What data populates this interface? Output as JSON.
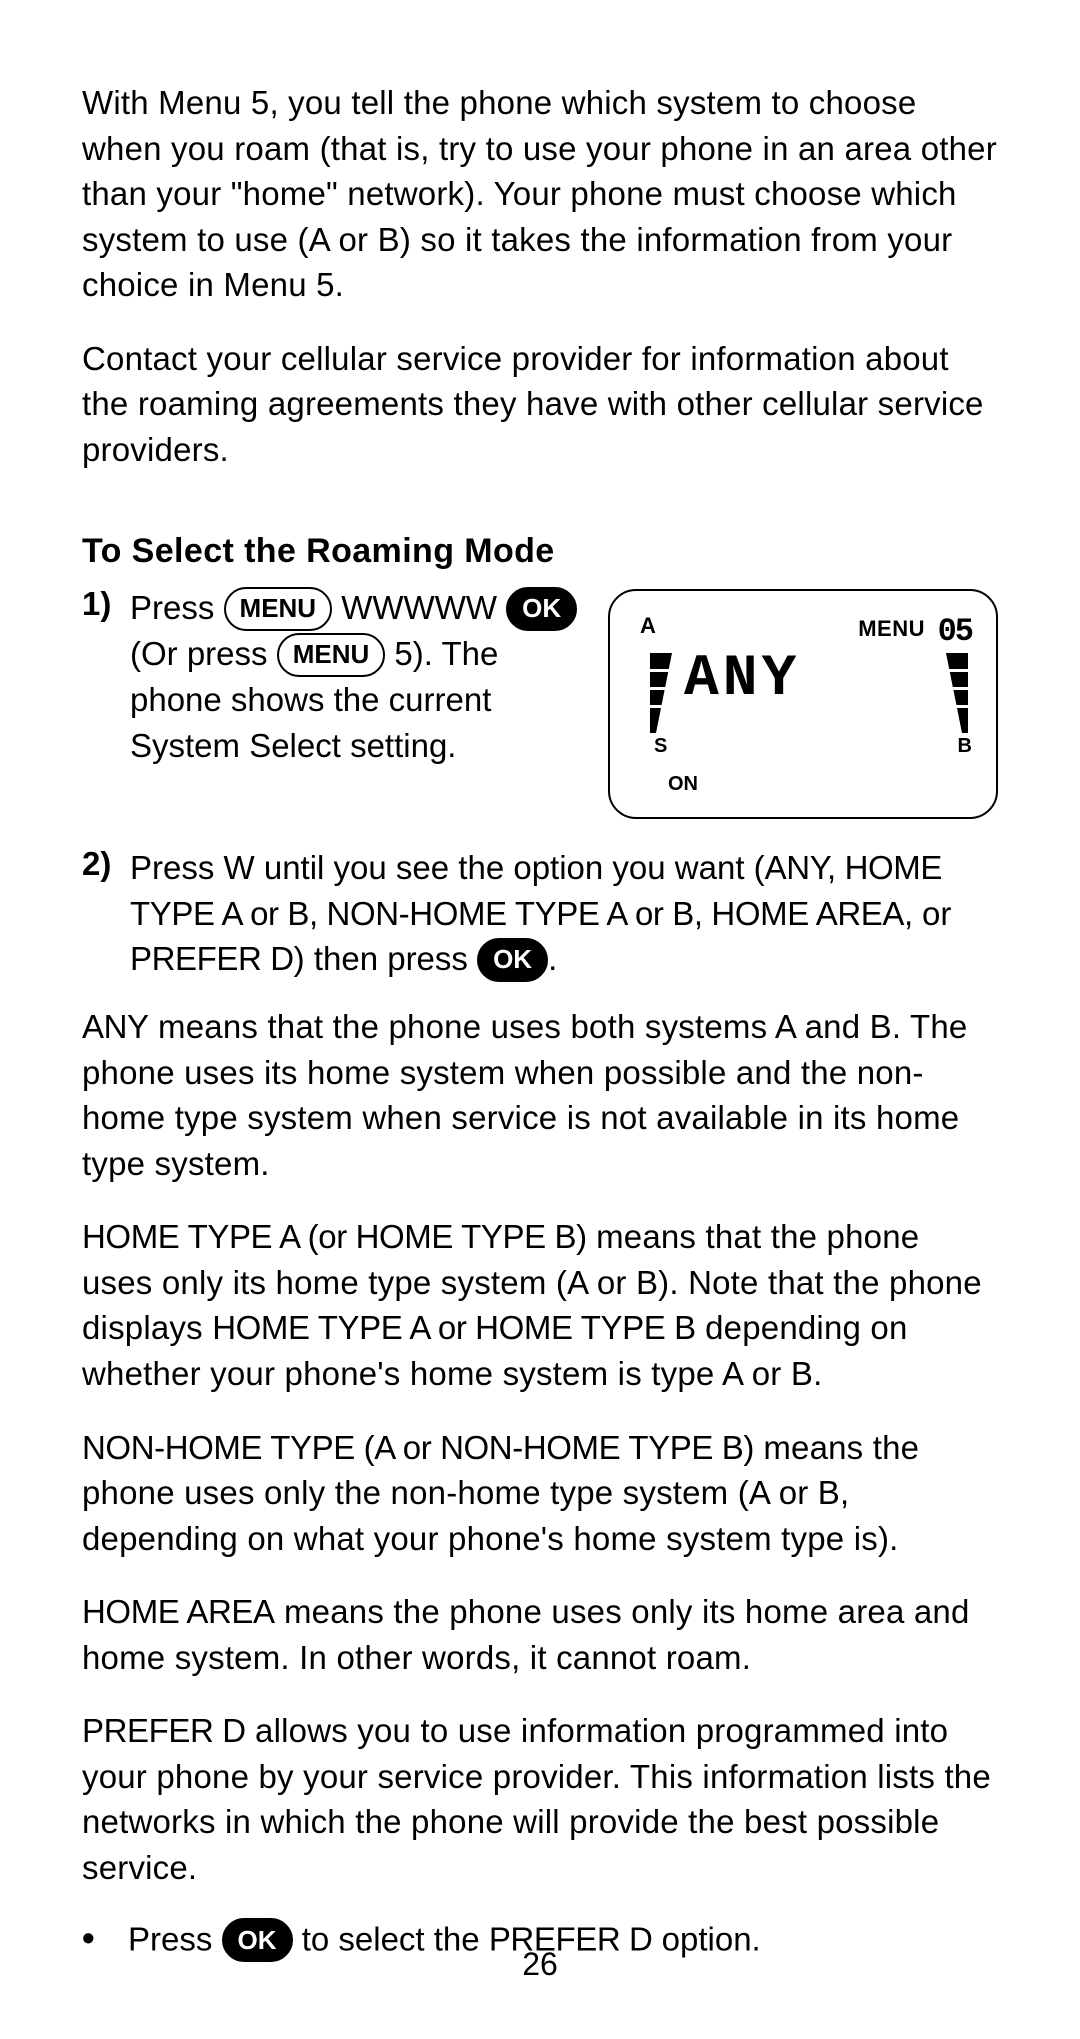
{
  "body": {
    "intro1": "With Menu 5, you tell the phone which system to choose when you roam (that is, try to use your phone in an area other than your \"home\" network). Your phone must choose which system to use (A or B) so it takes the information from your choice in Menu 5.",
    "intro2": "Contact your cellular service provider for information about the roaming agreements they have with other cellular service providers.",
    "heading": "To Select the Roaming Mode",
    "step1": {
      "num": "1)",
      "press": "Press ",
      "after_menu": " WWWWW ",
      "orpress": " (Or press ",
      "tail": " 5). The phone shows the current System Select setting.",
      "btn_menu": "MENU",
      "btn_ok": "OK"
    },
    "step2": {
      "num": "2)",
      "a": "Press W until you see the option you want (",
      "opt": "ANY, HOME TYPE A or B, NON-HOME TYPE A or B, HOME AREA,",
      "b": " or ",
      "opt2": "PREFER D",
      "c": ") then press ",
      "d": ".",
      "btn_ok": "OK"
    },
    "any_label": "ANY",
    "any_text": " means that the phone uses both systems A and B. The phone uses its home system when possible and the non-home type system when service is not available in its home type system.",
    "hometype_label": "HOME TYPE A (or HOME TYPE B)",
    "hometype_text": " means that the phone uses only its home type system (A or B). Note that the phone displays ",
    "hometype_labels2": "HOME TYPE A or HOME TYPE B",
    "hometype_text2": " depending on whether your phone's home system is type A or B.",
    "nonhome_label": "NON-HOME TYPE (A or NON-HOME TYPE B)",
    "nonhome_text": " means the phone uses only the non-home type system (A or B, depending on what your phone's home system type is).",
    "homearea_label": "HOME AREA",
    "homearea_text": " means the phone uses only its home area and home system. In other words, it cannot roam.",
    "preferd_label": "PREFER D",
    "preferd_text": " allows you to use information programmed into your phone by your service provider. This information lists the networks in which the phone will provide the best possible service.",
    "bullet": {
      "dot": "•",
      "a": "Press ",
      "b": " to select the ",
      "c": "PREFER D",
      "d": " option.",
      "btn_ok": "OK"
    },
    "page_num": "26"
  },
  "lcd": {
    "top_a": "A",
    "menu_label": "MENU",
    "menu_num": "05",
    "main": "ANY",
    "s": "S",
    "b": "B",
    "on": "ON"
  }
}
